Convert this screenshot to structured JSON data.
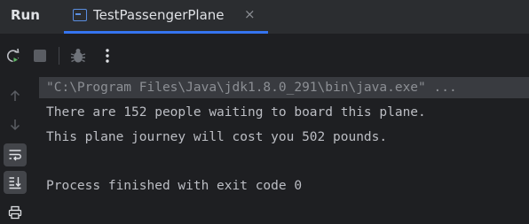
{
  "panel": {
    "title": "Run"
  },
  "tab": {
    "label": "TestPassengerPlane",
    "close_glyph": "×",
    "icon": "java-class-icon",
    "accent": "#3574f0"
  },
  "toolbar": {
    "buttons": [
      {
        "icon": "rerun-icon"
      },
      {
        "icon": "stop-icon"
      },
      {
        "icon": "debug-icon"
      },
      {
        "icon": "more-icon",
        "glyph": "⋮"
      }
    ]
  },
  "gutter": {
    "buttons": [
      {
        "icon": "arrow-up-icon"
      },
      {
        "icon": "arrow-down-icon"
      },
      {
        "icon": "soft-wrap-icon",
        "active": true
      },
      {
        "icon": "scroll-to-end-icon",
        "active": true
      },
      {
        "icon": "print-icon"
      }
    ]
  },
  "console": {
    "command": "\"C:\\Program Files\\Java\\jdk1.8.0_291\\bin\\java.exe\" ...",
    "lines": [
      "There are 152 people waiting to board this plane.",
      "This plane journey will cost you 502 pounds.",
      "Process finished with exit code 0"
    ]
  }
}
